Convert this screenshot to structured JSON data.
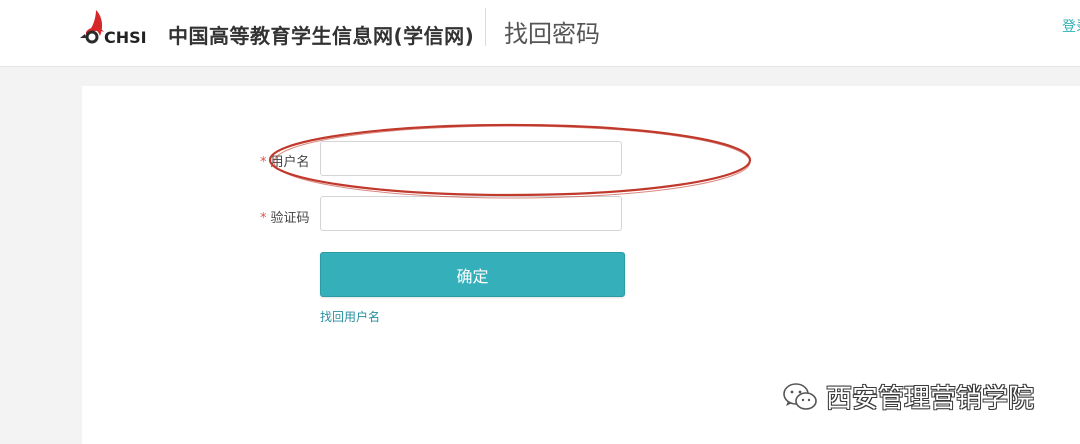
{
  "header": {
    "logo_text": "CHSI",
    "brand": "中国高等教育学生信息网(学信网)",
    "page_title": "找回密码",
    "login_link": "登录"
  },
  "form": {
    "username": {
      "required_mark": "*",
      "label": "用户名",
      "value": "",
      "placeholder": ""
    },
    "captcha": {
      "required_mark": "*",
      "label": "验证码",
      "value": "",
      "placeholder": ""
    },
    "confirm_button": "确定",
    "recover_username_link": "找回用户名"
  },
  "watermark": {
    "text": "西安管理营销学院"
  },
  "colors": {
    "accent": "#35afb9",
    "link": "#2a8fa0",
    "required": "#e05050",
    "annotation": "#c0392b",
    "logo_red": "#d62828"
  }
}
